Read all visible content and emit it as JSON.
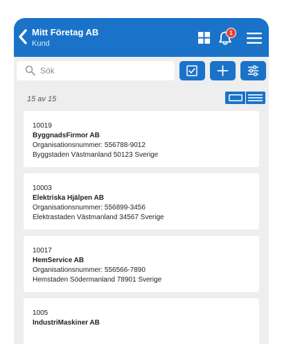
{
  "header": {
    "title": "Mitt Företag AB",
    "subtitle": "Kund",
    "notification_count": "1"
  },
  "search": {
    "placeholder": "Sök",
    "value": ""
  },
  "list": {
    "count_text": "15 av 15",
    "items": [
      {
        "id": "10019",
        "name": "ByggnadsFirmor AB",
        "org": "Organisationsnummer: 556788-9012",
        "address": "Byggstaden Västmanland 50123 Sverige"
      },
      {
        "id": "10003",
        "name": "Elektriska Hjälpen AB",
        "org": "Organisationsnummer: 556899-3456",
        "address": "Elektrastaden Västmanland 34567 Sverige"
      },
      {
        "id": "10017",
        "name": "HemService AB",
        "org": "Organisationsnummer: 556566-7890",
        "address": "Hemstaden Södermanland 78901 Sverige"
      },
      {
        "id": "1005",
        "name": "IndustriMaskiner AB",
        "org": "",
        "address": ""
      }
    ]
  },
  "colors": {
    "brand_blue": "#1a73c8",
    "background": "#eeeeee",
    "badge_red": "#e8403a"
  },
  "icons": {
    "back": "chevron-left-icon",
    "grid": "grid-icon",
    "bell": "bell-icon",
    "menu": "hamburger-menu-icon",
    "search": "search-icon",
    "select": "checkbox-icon",
    "add": "plus-icon",
    "filter": "sliders-icon"
  }
}
